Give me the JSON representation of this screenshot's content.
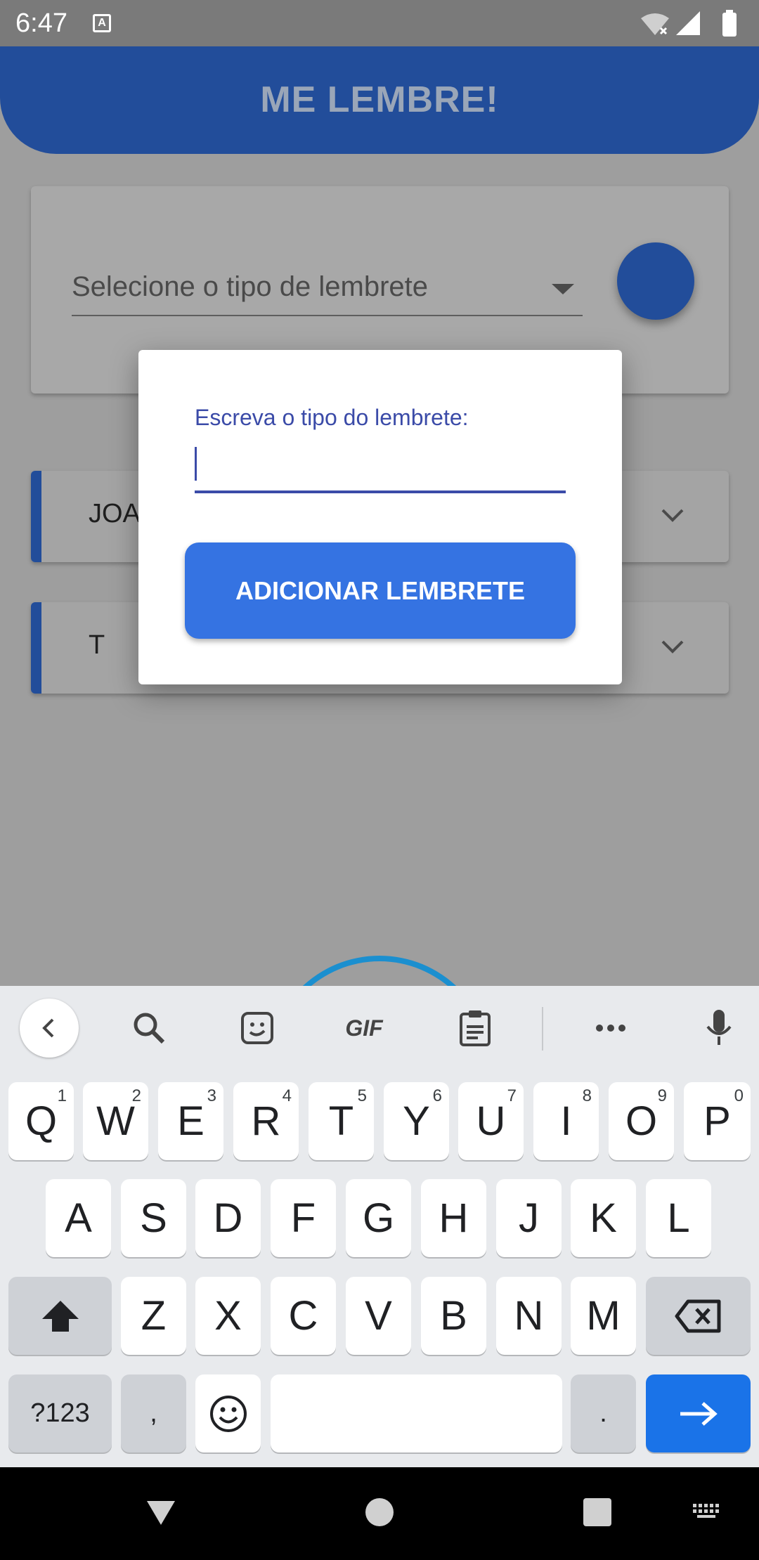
{
  "status_bar": {
    "time": "6:47",
    "notification_icon": "A"
  },
  "app_bar": {
    "title": "ME LEMBRE!"
  },
  "select": {
    "placeholder": "Selecione o tipo de lembrete"
  },
  "list": [
    {
      "label": "JOA"
    },
    {
      "label": "T"
    }
  ],
  "dialog": {
    "label": "Escreva o tipo do lembrete:",
    "input_value": "",
    "button": "ADICIONAR LEMBRETE"
  },
  "keyboard": {
    "toolbar": {
      "gif": "GIF",
      "icons": [
        "back-icon",
        "search-icon",
        "sticker-icon",
        "gif-icon",
        "clipboard-icon",
        "more-icon",
        "mic-icon"
      ]
    },
    "row1": [
      {
        "k": "Q",
        "h": "1"
      },
      {
        "k": "W",
        "h": "2"
      },
      {
        "k": "E",
        "h": "3"
      },
      {
        "k": "R",
        "h": "4"
      },
      {
        "k": "T",
        "h": "5"
      },
      {
        "k": "Y",
        "h": "6"
      },
      {
        "k": "U",
        "h": "7"
      },
      {
        "k": "I",
        "h": "8"
      },
      {
        "k": "O",
        "h": "9"
      },
      {
        "k": "P",
        "h": "0"
      }
    ],
    "row2": [
      "A",
      "S",
      "D",
      "F",
      "G",
      "H",
      "J",
      "K",
      "L"
    ],
    "row3": [
      "Z",
      "X",
      "C",
      "V",
      "B",
      "N",
      "M"
    ],
    "row4": {
      "symbols": "?123",
      "comma": ",",
      "period": "."
    }
  },
  "colors": {
    "primary": "#224d9a",
    "button": "#3573e2",
    "input_accent": "#3b4ba8",
    "enter_key": "#1a73e8"
  }
}
